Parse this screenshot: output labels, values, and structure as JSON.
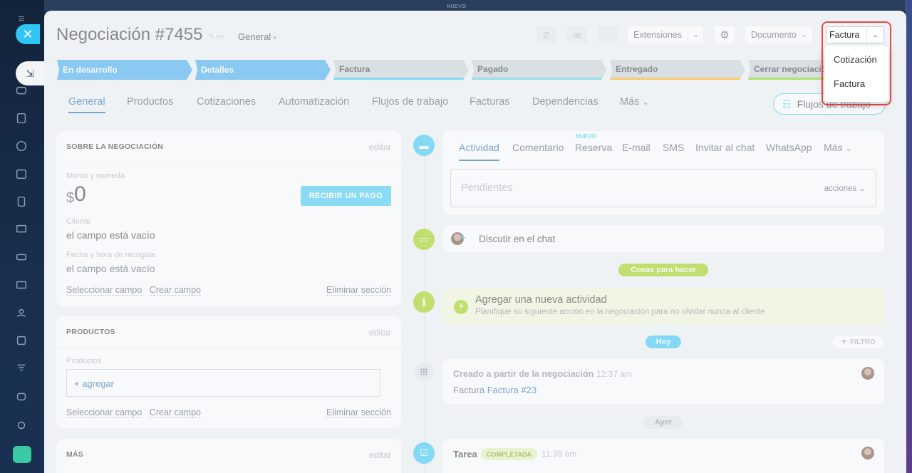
{
  "top": {
    "nuevo": "NUEVO"
  },
  "header": {
    "title": "Negociación #7455",
    "pipeline": "General",
    "extensions": "Extensiones",
    "document": "Documento",
    "invoice_btn": "Factura"
  },
  "dropdown": {
    "items": [
      "Cotización",
      "Factura"
    ]
  },
  "stages": [
    {
      "label": "En desarrollo",
      "state": "active",
      "color": "#39a8ef"
    },
    {
      "label": "Detalles",
      "state": "active",
      "color": "#39a8ef"
    },
    {
      "label": "Factura",
      "state": "inactive",
      "color": "#2fc6f6"
    },
    {
      "label": "Pagado",
      "state": "inactive",
      "color": "#55d0e0"
    },
    {
      "label": "Entregado",
      "state": "inactive",
      "color": "#ffa900"
    },
    {
      "label": "Cerrar negociación",
      "state": "inactive",
      "color": "#7bd500"
    }
  ],
  "tabs": [
    "General",
    "Productos",
    "Cotizaciones",
    "Automatización",
    "Flujos de trabajo",
    "Facturas",
    "Dependencias",
    "Más"
  ],
  "flows_button": "Flujos de trabajo",
  "about": {
    "title": "SOBRE LA NEGOCIACIÓN",
    "edit": "editar",
    "amount_label": "Monto y moneda",
    "currency": "$",
    "amount": "0",
    "pay_button": "RECIBIR UN PAGO",
    "client_label": "Cliente",
    "client_value": "el campo está vacío",
    "pickup_label": "Fecha y hora de recogida",
    "pickup_value": "el campo está vacío",
    "select_field": "Seleccionar campo",
    "create_field": "Crear campo",
    "delete_section": "Eliminar sección"
  },
  "products": {
    "title": "PRODUCTOS",
    "edit": "editar",
    "label": "Productos",
    "add": "+ agregar",
    "select_field": "Seleccionar campo",
    "create_field": "Crear campo",
    "delete_section": "Eliminar sección"
  },
  "more": {
    "title": "MÁS",
    "edit": "editar"
  },
  "activity": {
    "tabs": [
      "Actividad",
      "Comentario",
      "Reserva",
      "E-mail",
      "SMS",
      "Invitar al chat",
      "WhatsApp",
      "Más"
    ],
    "nuevo": "NUEVO",
    "pending": "Pendientes",
    "actions": "acciones"
  },
  "chat": {
    "label": "Discutir en el chat"
  },
  "todo_pill": "Cosas para hacer",
  "new_activity": {
    "title": "Agregar una nueva actividad",
    "subtitle": "Planifique su siguiente acción en la negociación para no olvidar nunca al cliente"
  },
  "today_pill": "Hoy",
  "filter": "FILTRO",
  "created": {
    "title": "Creado a partir de la negociación",
    "time": "12:37 am",
    "prefix": "Factura",
    "link": "Factura #23"
  },
  "yesterday_pill": "Ayer",
  "task": {
    "title": "Tarea",
    "badge": "COMPLETADA",
    "time": "11:39 am"
  }
}
